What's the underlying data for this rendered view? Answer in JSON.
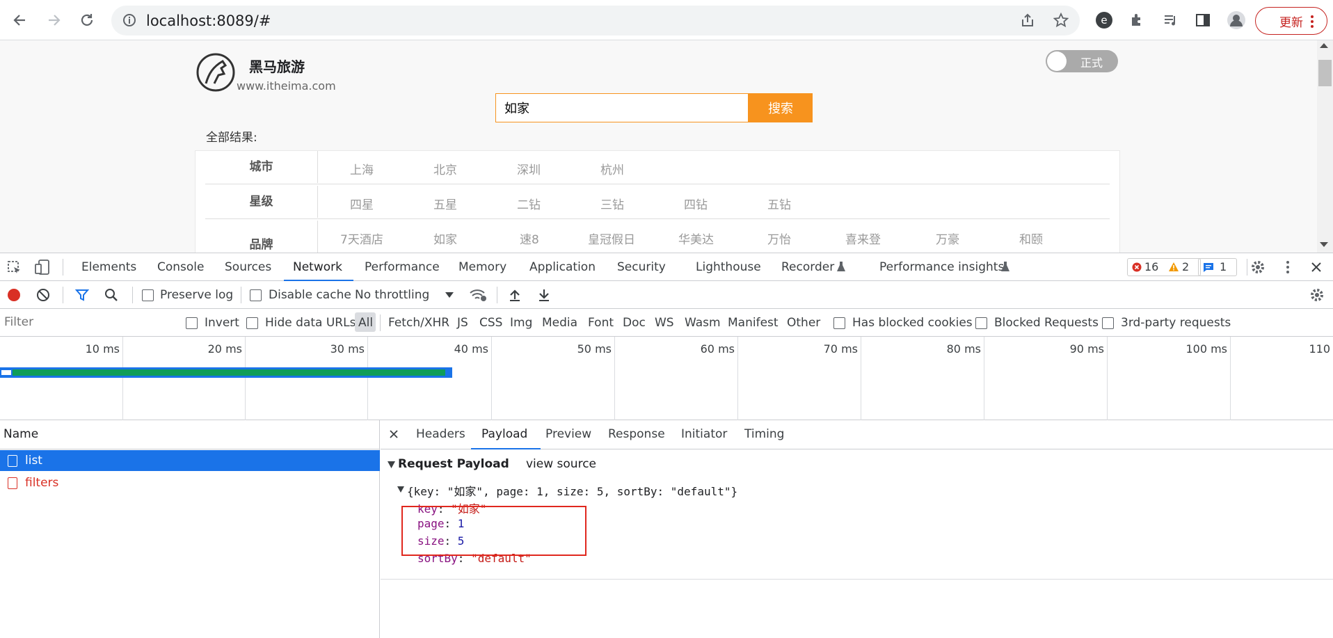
{
  "browser": {
    "url": "localhost:8089/#",
    "update_label": "更新"
  },
  "site": {
    "logo_title": "黑马旅游",
    "logo_url": "www.itheima.com",
    "toggle_label": "正式",
    "search_value": "如家",
    "search_button": "搜索",
    "all_results": "全部结果:",
    "filters": [
      {
        "label": "城市",
        "options": [
          "上海",
          "北京",
          "深圳",
          "杭州"
        ]
      },
      {
        "label": "星级",
        "options": [
          "四星",
          "五星",
          "二钻",
          "三钻",
          "四钻",
          "五钻"
        ]
      },
      {
        "label": "品牌",
        "options": [
          "7天酒店",
          "如家",
          "速8",
          "皇冠假日",
          "华美达",
          "万怡",
          "喜来登",
          "万豪",
          "和颐"
        ]
      }
    ]
  },
  "devtools": {
    "tabs": [
      "Elements",
      "Console",
      "Sources",
      "Network",
      "Performance",
      "Memory",
      "Application",
      "Security",
      "Lighthouse",
      "Recorder",
      "Performance insights"
    ],
    "active_tab": "Network",
    "error_count": "16",
    "warning_count": "2",
    "issue_count": "1",
    "toolbar": {
      "preserve_log": "Preserve log",
      "disable_cache": "Disable cache",
      "throttling": "No throttling"
    },
    "filter": {
      "placeholder": "Filter",
      "invert": "Invert",
      "hide_data_urls": "Hide data URLs",
      "types": [
        "All",
        "Fetch/XHR",
        "JS",
        "CSS",
        "Img",
        "Media",
        "Font",
        "Doc",
        "WS",
        "Wasm",
        "Manifest",
        "Other"
      ],
      "has_blocked_cookies": "Has blocked cookies",
      "blocked_requests": "Blocked Requests",
      "third_party": "3rd-party requests"
    },
    "timeline_ticks": [
      "10 ms",
      "20 ms",
      "30 ms",
      "40 ms",
      "50 ms",
      "60 ms",
      "70 ms",
      "80 ms",
      "90 ms",
      "100 ms",
      "110"
    ],
    "request_list": {
      "header": "Name",
      "rows": [
        {
          "name": "list",
          "selected": true,
          "error": false
        },
        {
          "name": "filters",
          "selected": false,
          "error": true
        }
      ]
    },
    "detail": {
      "tabs": [
        "Headers",
        "Payload",
        "Preview",
        "Response",
        "Initiator",
        "Timing"
      ],
      "active_tab": "Payload",
      "section_title": "Request Payload",
      "view_source": "view source",
      "summary": "{key: \"如家\", page: 1, size: 5, sortBy: \"default\"}",
      "fields": [
        {
          "key": "key",
          "value": "\"如家\"",
          "type": "str"
        },
        {
          "key": "page",
          "value": "1",
          "type": "num"
        },
        {
          "key": "size",
          "value": "5",
          "type": "num"
        },
        {
          "key": "sortBy",
          "value": "\"default\"",
          "type": "str"
        }
      ]
    }
  }
}
